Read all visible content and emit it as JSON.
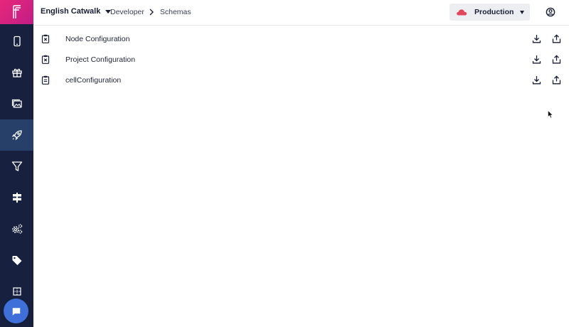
{
  "app": {
    "brand_color": "#e6287a",
    "sidebar_color": "#17213f",
    "accent_color": "#3f6fd8"
  },
  "sidebar": {
    "items": [
      {
        "name": "mobile-icon",
        "active": false
      },
      {
        "name": "gift-icon",
        "active": false
      },
      {
        "name": "gallery-icon",
        "active": false
      },
      {
        "name": "rocket-icon",
        "active": true
      },
      {
        "name": "filter-icon",
        "active": false
      },
      {
        "name": "signpost-icon",
        "active": false
      },
      {
        "name": "gears-icon",
        "active": false
      },
      {
        "name": "tag-icon",
        "active": false
      },
      {
        "name": "grid-icon",
        "active": false
      }
    ],
    "chat_icon": "chat-icon"
  },
  "header": {
    "project": "English Catwalk",
    "breadcrumb": [
      "Developer",
      "Schemas"
    ],
    "environment": "Production",
    "environment_color": "#e0475a"
  },
  "schemas": {
    "rows": [
      {
        "label": "Node Configuration",
        "icon": "clipboard-x-icon"
      },
      {
        "label": "Project Configuration",
        "icon": "clipboard-x-icon"
      },
      {
        "label": "cellConfiguration",
        "icon": "clipboard-text-icon"
      }
    ]
  }
}
